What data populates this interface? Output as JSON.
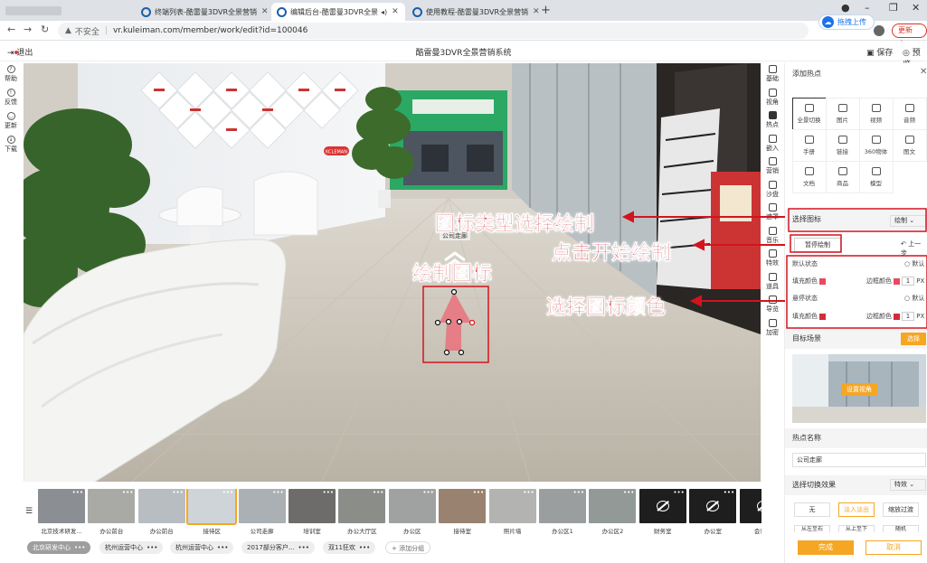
{
  "browser": {
    "tabs": [
      {
        "label": "终端列表-酷雷曼3DVR全景营销",
        "active": false
      },
      {
        "label": "编辑后台-酷雷曼3DVR全景",
        "active": true
      },
      {
        "label": "使用教程-酷雷曼3DVR全景营销",
        "active": false
      }
    ],
    "insecure": "不安全",
    "url": "vr.kuleiman.com/member/work/edit?id=100046",
    "update_btn": "更新",
    "upload_pill": "拖拽上传"
  },
  "app": {
    "exit": "退出",
    "title": "酷雷曼3DVR全景营销系统",
    "save": "保存",
    "preview": "预览"
  },
  "left_tools": [
    {
      "label": "帮助",
      "icon": "help-icon"
    },
    {
      "label": "反馈",
      "icon": "info-icon"
    },
    {
      "label": "更新",
      "icon": "update-icon"
    },
    {
      "label": "下载",
      "icon": "download-icon"
    }
  ],
  "right_icons": [
    {
      "label": "基础",
      "icon": "home-icon"
    },
    {
      "label": "视角",
      "icon": "eye-icon"
    },
    {
      "label": "热点",
      "icon": "hotspot-icon",
      "active": true
    },
    {
      "label": "嵌入",
      "icon": "embed-icon"
    },
    {
      "label": "营销",
      "icon": "chart-icon"
    },
    {
      "label": "沙盘",
      "icon": "person-icon"
    },
    {
      "label": "遮罩",
      "icon": "doc-icon"
    },
    {
      "label": "音乐",
      "icon": "sound-icon"
    },
    {
      "label": "特效",
      "icon": "effect-icon"
    },
    {
      "label": "道具",
      "icon": "prop-icon"
    },
    {
      "label": "导览",
      "icon": "guide-icon"
    },
    {
      "label": "加密",
      "icon": "lock-icon"
    }
  ],
  "panel": {
    "title": "添加热点",
    "types": [
      "全景切换",
      "图片",
      "视频",
      "音频",
      "手册",
      "链接",
      "360物体",
      "图文",
      "文档",
      "商品",
      "模型"
    ],
    "select_icon_label": "选择图标",
    "select_icon_value": "绘制",
    "pause_draw": "暂停绘制",
    "undo": "上一步",
    "default_state": "默认状态",
    "default_reset": "默认",
    "fill_color": "填充颜色",
    "border_color": "边框颜色",
    "px_value": "1",
    "px_unit": "PX",
    "hover_state": "悬停状态",
    "target_scene": "目标场景",
    "choose": "选择",
    "set_view": "设置视角",
    "hotspot_name_label": "热点名称",
    "hotspot_name_value": "公司走廊",
    "switch_effect_label": "选择切换效果",
    "effect_value": "特效",
    "effects": [
      "无",
      "淡入淡出",
      "缩放过渡"
    ],
    "effects_row2": [
      "从左至右",
      "从上至下",
      "随机"
    ],
    "confirm": "完成",
    "cancel": "取消"
  },
  "scene": {
    "hotspot_label": "公司走廊",
    "annotations": {
      "draw_icon": "绘制图标",
      "type_select": "图标类型选择绘制",
      "click_start": "点击开始绘制",
      "select_color": "选择图标颜色"
    },
    "logo_sign": "KCLEMAN"
  },
  "thumbnails": [
    {
      "name": "北京技术研发...",
      "tone": "#8b8f94"
    },
    {
      "name": "办公前台",
      "tone": "#a9aaa6"
    },
    {
      "name": "办公前台",
      "tone": "#b8bdc2"
    },
    {
      "name": "接待区",
      "tone": "#cfd4d8",
      "selected": true
    },
    {
      "name": "公司走廊",
      "tone": "#aab0b3"
    },
    {
      "name": "培训室",
      "tone": "#6d6c6a"
    },
    {
      "name": "办公大厅区",
      "tone": "#8a8d88"
    },
    {
      "name": "办公区",
      "tone": "#9fa2a0"
    },
    {
      "name": "接待室",
      "tone": "#9a8270"
    },
    {
      "name": "照片墙",
      "tone": "#b3b3b1"
    },
    {
      "name": "办公区1",
      "tone": "#9a9e9e"
    },
    {
      "name": "办公区2",
      "tone": "#939997"
    },
    {
      "name": "财务室",
      "tone": "#1e1e1e",
      "hidden": true
    },
    {
      "name": "办公室",
      "tone": "#1e1e1e",
      "hidden": true
    },
    {
      "name": "会议室",
      "tone": "#1e1e1e",
      "hidden": true
    }
  ],
  "groups": [
    {
      "label": "北京研发中心",
      "selected": true
    },
    {
      "label": "杭州运营中心",
      "selected": false
    },
    {
      "label": "杭州运营中心",
      "selected": false
    },
    {
      "label": "2017部分客户...",
      "selected": false
    },
    {
      "label": "双11狂欢",
      "selected": false
    }
  ],
  "add_group": "+ 添加分组",
  "colors": {
    "accent": "#f5a623",
    "annotation": "#d2141e",
    "fill": "#e84a5f"
  }
}
